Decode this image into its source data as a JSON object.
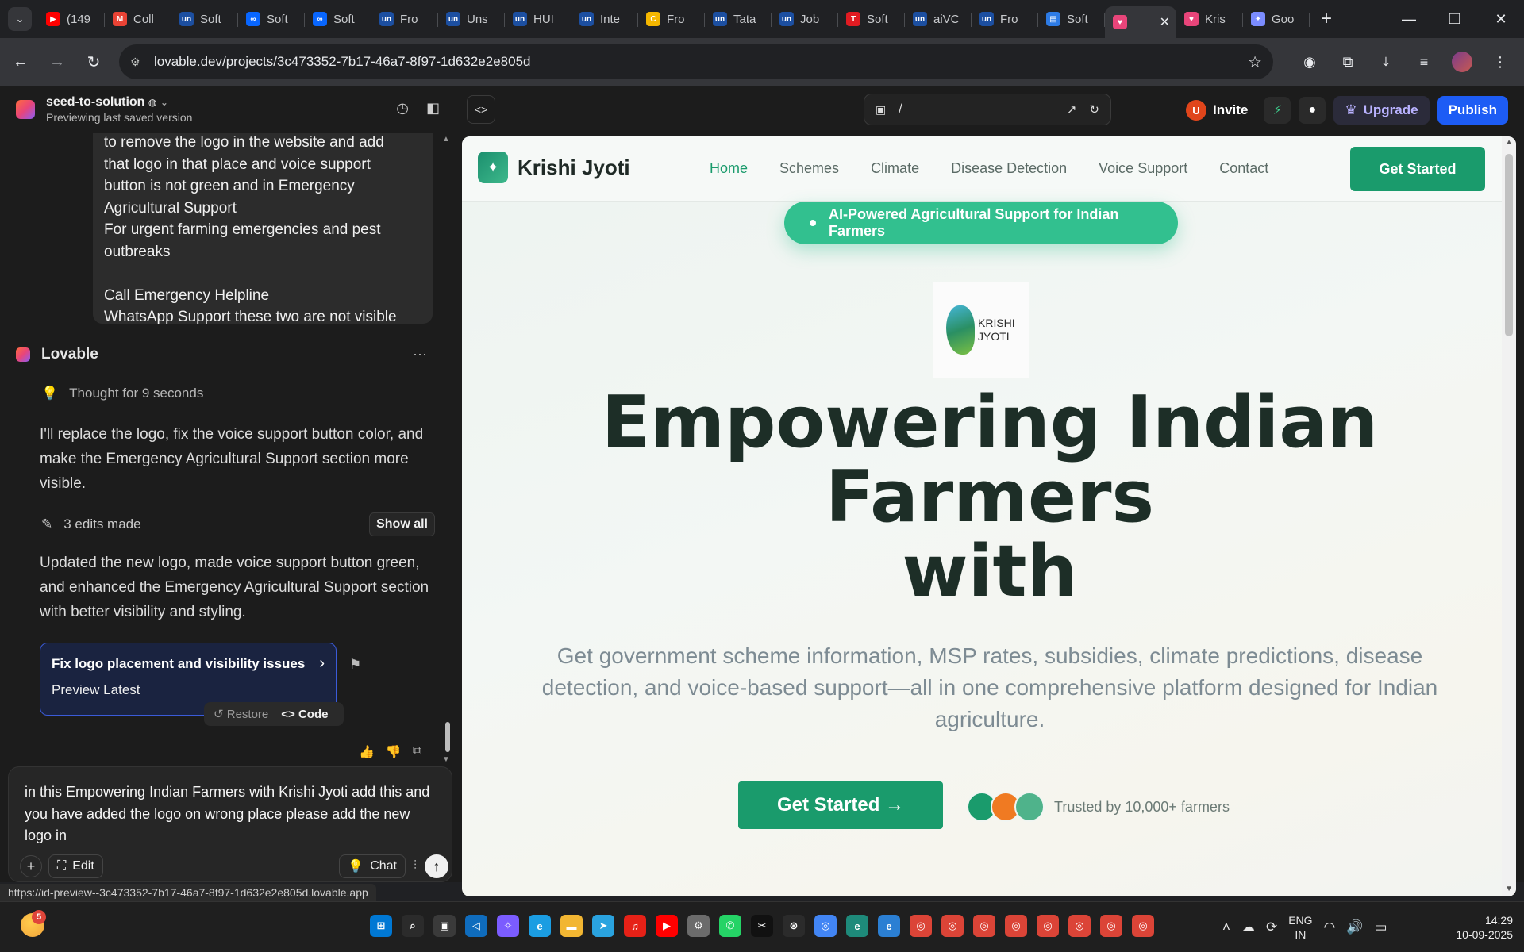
{
  "browser": {
    "tabs": [
      {
        "label": "(149",
        "icon": "youtube-icon",
        "color": "#ff0000"
      },
      {
        "label": "Coll",
        "icon": "gmail-icon",
        "color": "#ea4335"
      },
      {
        "label": "Soft",
        "icon": "unstop-icon",
        "color": "#1c4fa1"
      },
      {
        "label": "Soft",
        "icon": "meta-icon",
        "color": "#0866ff"
      },
      {
        "label": "Soft",
        "icon": "meta-icon",
        "color": "#0866ff"
      },
      {
        "label": "Fro",
        "icon": "unstop-icon",
        "color": "#1c4fa1"
      },
      {
        "label": "Uns",
        "icon": "unstop-icon",
        "color": "#1c4fa1"
      },
      {
        "label": "HUI",
        "icon": "unstop-icon",
        "color": "#1c4fa1"
      },
      {
        "label": "Inte",
        "icon": "unstop-icon",
        "color": "#1c4fa1"
      },
      {
        "label": "Fro",
        "icon": "crescent-icon",
        "color": "#f5b700"
      },
      {
        "label": "Tata",
        "icon": "unstop-icon",
        "color": "#1c4fa1"
      },
      {
        "label": "Job",
        "icon": "unstop-icon",
        "color": "#1c4fa1"
      },
      {
        "label": "Soft",
        "icon": "t-logo-icon",
        "color": "#e11b22"
      },
      {
        "label": "aiVC",
        "icon": "unstop-icon",
        "color": "#1c4fa1"
      },
      {
        "label": "Fro",
        "icon": "unstop-icon",
        "color": "#1c4fa1"
      },
      {
        "label": "Soft",
        "icon": "chart-icon",
        "color": "#2d7be5"
      },
      {
        "label": "",
        "icon": "lovable-icon",
        "color": "#e8457a",
        "active": true
      },
      {
        "label": "Kris",
        "icon": "lovable-icon",
        "color": "#e8457a"
      },
      {
        "label": "Goo",
        "icon": "gemini-icon",
        "color": "#7b8cff"
      }
    ],
    "url": "lovable.dev/projects/3c473352-7b17-46a7-8f97-1d632e2e805d",
    "status_url": "https://id-preview--3c473352-7b17-46a7-8f97-1d632e2e805d.lovable.app"
  },
  "editor": {
    "project_name": "seed-to-solution",
    "project_sub": "Previewing last saved version",
    "preview_path": "/",
    "invite_initial": "U",
    "invite_label": "Invite",
    "upgrade_label": "Upgrade",
    "publish_label": "Publish"
  },
  "chat": {
    "user_message_lines": [
      "to remove the logo in the website and add",
      "that logo in that place and voice support",
      "button is not green and in Emergency",
      "Agricultural Support",
      "For urgent farming emergencies and pest",
      "outbreaks",
      "",
      "Call Emergency Helpline",
      "WhatsApp Support these two are not visible"
    ],
    "assistant_name": "Lovable",
    "thought": "Thought for 9 seconds",
    "reply": "I'll replace the logo, fix the voice support button color, and make the Emergency Agricultural Support section more visible.",
    "edits_label": "3 edits made",
    "show_all": "Show all",
    "summary": "Updated the new logo, made voice support button green, and enhanced the Emergency Agricultural Support section with better visibility and styling.",
    "card_title": "Fix logo placement and visibility issues",
    "card_sub": "Preview Latest",
    "restore": "Restore",
    "code": "Code",
    "input_text": "in this Empowering Indian Farmers with Krishi Jyoti add this  and you have added the logo on wrong place please add the new logo in",
    "edit_label": "Edit",
    "chat_label": "Chat"
  },
  "site": {
    "brand": "Krishi Jyoti",
    "nav": [
      "Home",
      "Schemes",
      "Climate",
      "Disease Detection",
      "Voice Support",
      "Contact"
    ],
    "cta": "Get Started",
    "badge": "AI-Powered Agricultural Support for Indian Farmers",
    "logo_text": "KRISHI JYOTI",
    "headline_1": "Empowering Indian Farmers",
    "headline_2": "with",
    "lead": "Get government scheme information, MSP rates, subsidies, climate predictions, disease detection, and voice-based support—all in one comprehensive platform designed for Indian agriculture.",
    "cta_main": "Get Started →",
    "trust": "Trusted by 10,000+ farmers",
    "avatar_colors": [
      "#1a9b6c",
      "#f07a22",
      "#4fb38b"
    ],
    "brand_green": "#1a9b6c"
  },
  "taskbar": {
    "weather_badge": "5",
    "apps": [
      "windows-start",
      "search",
      "task-view",
      "vscode",
      "copilot",
      "edge",
      "file-explorer",
      "telegram",
      "youtube-music",
      "youtube",
      "settings",
      "whatsapp",
      "capcut",
      "chatgpt",
      "chrome",
      "edge-dev",
      "edge-beta",
      "chrome-profile-1",
      "chrome-profile-2",
      "chrome-profile-3",
      "chrome-profile-4",
      "chrome-profile-5",
      "chrome-profile-6",
      "chrome-profile-7",
      "chrome-profile-8"
    ],
    "lang_1": "ENG",
    "lang_2": "IN",
    "time": "14:29",
    "date": "10-09-2025"
  }
}
